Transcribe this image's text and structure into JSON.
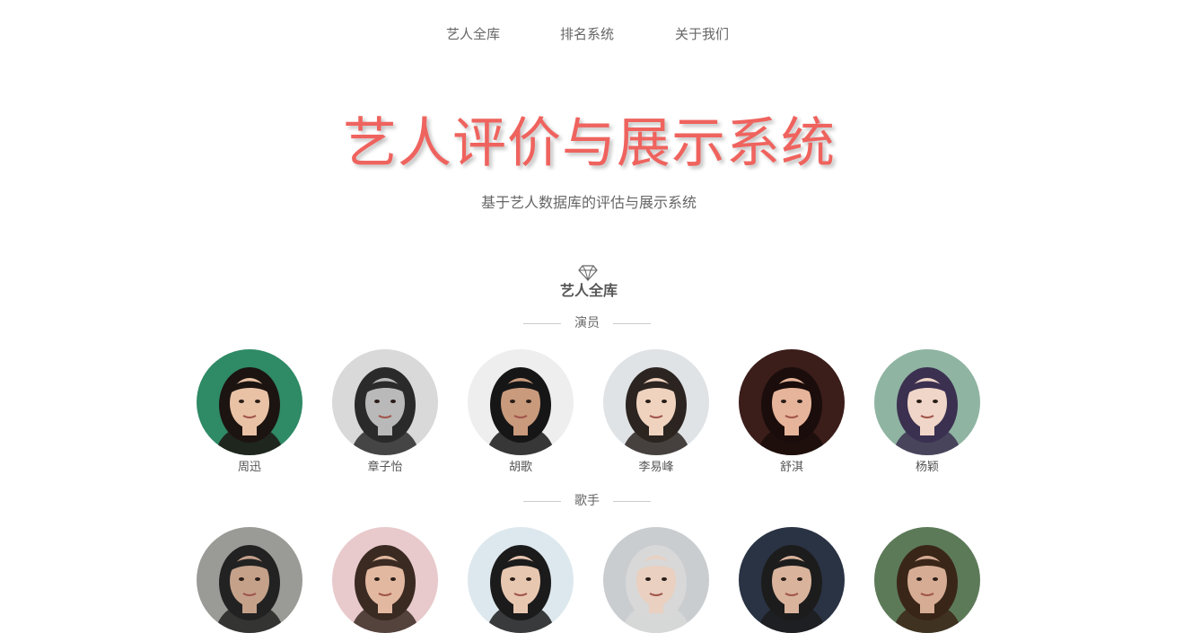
{
  "nav": {
    "items": [
      {
        "label": "艺人全库"
      },
      {
        "label": "排名系统"
      },
      {
        "label": "关于我们"
      }
    ]
  },
  "hero": {
    "title": "艺人评价与展示系统",
    "subtitle": "基于艺人数据库的评估与展示系统",
    "title_color": "#ef635e"
  },
  "section": {
    "icon": "diamond-icon",
    "title": "艺人全库"
  },
  "actors": {
    "label": "演员",
    "people": [
      {
        "name": "周迅",
        "bg": "#2f8a66",
        "skin": "#e9c2a6",
        "hair": "#1c1410"
      },
      {
        "name": "章子怡",
        "bg": "#d9d9d9",
        "skin": "#b9b9b9",
        "hair": "#2a2a2a"
      },
      {
        "name": "胡歌",
        "bg": "#eeeeee",
        "skin": "#c99a7c",
        "hair": "#161616"
      },
      {
        "name": "李易峰",
        "bg": "#dfe3e6",
        "skin": "#efd3bf",
        "hair": "#2b2420"
      },
      {
        "name": "舒淇",
        "bg": "#3b1d1a",
        "skin": "#e6b49a",
        "hair": "#1a0d0b"
      },
      {
        "name": "杨颖",
        "bg": "#8fb4a2",
        "skin": "#f0d6c8",
        "hair": "#3b3050"
      }
    ]
  },
  "singers": {
    "label": "歌手",
    "people": [
      {
        "bg": "#9a9a96",
        "skin": "#c5a18a",
        "hair": "#222222"
      },
      {
        "bg": "#e8c9cc",
        "skin": "#e2b8a0",
        "hair": "#3a2a22"
      },
      {
        "bg": "#dde8ee",
        "skin": "#e8c7b1",
        "hair": "#1b1b1b"
      },
      {
        "bg": "#c9cdd0",
        "skin": "#e9d0c0",
        "hair": "#d8d8d8"
      },
      {
        "bg": "#2a3344",
        "skin": "#d9b39c",
        "hair": "#1c1c1c"
      },
      {
        "bg": "#5c7a58",
        "skin": "#d6ac94",
        "hair": "#3a2618"
      }
    ]
  }
}
